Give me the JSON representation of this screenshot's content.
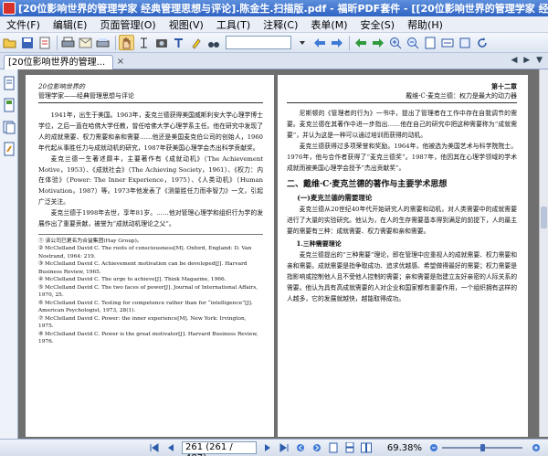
{
  "window": {
    "title": "[20位影响世界的管理学家  经典管理思想与评论].陈金生.扫描版.pdf - 福昕PDF套件 - [[20位影响世界的管理学家  经典管理思想与评论].陈金生.扫描版.pdf]"
  },
  "menu": {
    "items": [
      "文件(F)",
      "编辑(E)",
      "页面管理(O)",
      "视图(V)",
      "工具(T)",
      "注释(C)",
      "表单(M)",
      "安全(S)",
      "帮助(H)"
    ]
  },
  "tab": {
    "label": "[20位影响世界的管理...",
    "close": "×",
    "nav": "◀ ▶ ▼"
  },
  "pages": {
    "left": {
      "running_head": "20位影响世界的",
      "running_sub": "管理学家——经典管理思想与评论",
      "paragraphs": [
        "1941年，出生于美国。1963年，麦克兰德获得美国威斯利安大学心理学博士学位，之后一直在哈佛大学任教，曾任哈佛大学心理学系主任。他在研究中发现了人的成就需要、权力需要和亲和需要……他还是美国麦克伯公司的创始人，1960年代起从事胜任力与成就动机的研究，1987年获美国心理学会杰出科学贡献奖。",
        "麦克兰德一生著述颇丰，主要著作有《成就动机》（The Achievement Motive，1953）、《成就社会》（The Achieving Society，1961）、《权力：内在体验》（Power: The Inner Experience，1975）、《人类动机》（Human Motivation，1987）等。1973年他发表了《测量胜任力而非智力》一文，引起广泛关注。",
        "麦克兰德于1998年去世，享年81岁。……他对管理心理学和组织行为学的发展作出了重要贡献，被誉为“成就动机理论之父”。"
      ],
      "footnotes": [
        "① 该公司已更名为合益集团(Hay Group)。",
        "② McClelland David C. The roots of consciousness[M]. Oxford, England: D. Van Nostrand, 1964: 219.",
        "③ McClelland David C. Achievement motivation can be developed[J]. Harvard Business Review, 1965.",
        "④ McClelland David C. The urge to achieve[J]. Think Magazine, 1966.",
        "⑤ McClelland David C. The two faces of power[J]. Journal of International Affairs, 1970, 25.",
        "⑥ McClelland David C. Testing for competence rather than for “intelligence”[J]. American Psychologist, 1973, 28(1).",
        "⑦ McClelland David C. Power: the inner experience[M]. New York: Irvington, 1975.",
        "⑧ McClelland David C. Power is the great motivator[J]. Harvard Business Review, 1976."
      ]
    },
    "right": {
      "running_head": "第十二章",
      "running_sub": "戴维·C·麦克兰德：权力是最大的动力器",
      "paragraphs_top": [
        "尼斯顿的《管理者的行为》一书中，提出了管理者在工作中存在自我调节的需要。麦克兰德在其著作中进一步指出……他在自己的研究中把这种需要称为“成就需要”，并认为这是一种可以通过培训而获得的动机。",
        "麦克兰德获得过多项荣誉和奖励。1964年，他被选为美国艺术与科学院院士。1976年，他与合作者获得了“麦克兰德奖”。1987年，他因其在心理学领域的学术成就而被美国心理学会授予“杰出贡献奖”。"
      ],
      "h2": "二、戴维·C·麦克兰德的著作与主要学术思想",
      "h3": "(一)麦克兰德的需要理论",
      "paragraph_mid": "麦克兰德从20世纪40年代开始研究人的需要和动机，对人类需要中的成就需要进行了大量的实验研究。他认为，在人的生存需要基本得到满足的前提下，人的最主要的需要有三种：成就需要、权力需要和亲和需要。",
      "h4": "1.三种需要理论",
      "paragraph_bottom": "麦克兰德提出的“三种需要”理论，即在管理中应重视人的成就需要、权力需要和亲和需要。成就需要是指争取成功、追求优越感、希望做得最好的需要；权力需要是指影响或控制他人且不受他人控制的需要；亲和需要是指建立友好亲密的人际关系的需要。他认为具有高成就需要的人对企业和国家都有重要作用，一个组织拥有这样的人越多，它的发展就越快，越能取得成功。"
    }
  },
  "status": {
    "page_value": "261 (261 / 487)",
    "zoom": "69.38%",
    "zoom_level": 0.5
  }
}
